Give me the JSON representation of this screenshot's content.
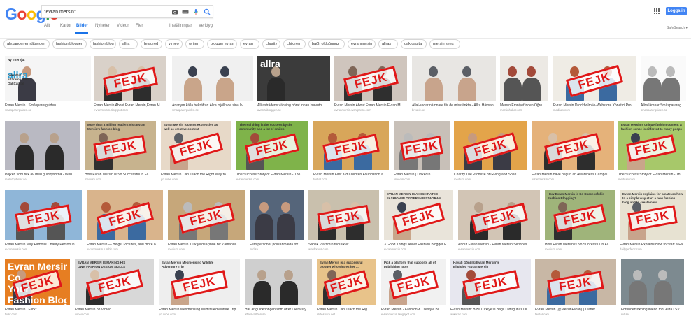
{
  "logo": {
    "letters": [
      "G",
      "o",
      "o",
      "g",
      "l",
      "e"
    ],
    "colors": [
      "#4285F4",
      "#EA4335",
      "#FBBC05",
      "#4285F4",
      "#34A853",
      "#EA4335"
    ]
  },
  "search": {
    "value": "\"evran mersin\"",
    "placeholder": ""
  },
  "tabs": [
    {
      "label": "Allt",
      "active": false
    },
    {
      "label": "Kartor",
      "active": false
    },
    {
      "label": "Bilder",
      "active": true
    },
    {
      "label": "Nyheter",
      "active": false
    },
    {
      "label": "Videor",
      "active": false
    },
    {
      "label": "Fler",
      "active": false
    },
    {
      "label": "Inställningar",
      "active": false
    },
    {
      "label": "Verktyg",
      "active": false
    }
  ],
  "header": {
    "login_label": "Logga in",
    "safesearch_label": "SafeSearch ▾"
  },
  "chips": [
    "alexander erndtberger",
    "fashion blogger",
    "fashion blog",
    "allra",
    "featured",
    "vimeo",
    "writer",
    "blogger evran",
    "evran",
    "charity",
    "children",
    "bağlı olduğunuz",
    "evranmersin",
    "allras",
    "oak capital",
    "mersin sees"
  ],
  "stamp_text": "FEJK",
  "colors": {
    "stamp": "#e01818",
    "link_blue": "#1a73e8",
    "button_blue": "#4285f4"
  },
  "rows": [
    [
      {
        "caption": "Evran Mersin | Småsparerguiden",
        "source": "smasparerguiden.se",
        "stamp": false,
        "overlay": [
          "Ny intervju:",
          "allra",
          "bekräftar",
          "affärerna med",
          "OakCapital"
        ]
      },
      {
        "caption": "Evran Mersin About Evran Mersin,Evran M...",
        "source": "evranmersin.blogspot.com",
        "stamp": true
      },
      {
        "caption": "Ananym källa bekräftar: Allra mjölkade sina liv...",
        "source": "smasparerguiden.se",
        "stamp": false
      },
      {
        "caption": "Allrastrådens vänsing börat innan kravutb...",
        "source": "avanzabloggen.se",
        "stamp": false,
        "overlay": [
          "allra"
        ]
      },
      {
        "caption": "Evran Mersin About Evran Mersin,Evran M...",
        "source": "evranmersin.wordpress.com",
        "stamp": true
      },
      {
        "caption": "Allal-sedar nämnare för de misstänkta - Allra Hävsan",
        "source": "breakit.se",
        "stamp": false
      },
      {
        "caption": "Mersin Emniyet'inden Öğre...",
        "source": "mersinhaber.com",
        "stamp": false
      },
      {
        "caption": "Evran Mersin Drockholm-ie-Webstore Yönetici Progr...",
        "source": "medium.com",
        "stamp": true
      },
      {
        "caption": "Allra lämnar Småsparareg...",
        "source": "smasparerguiden.se",
        "stamp": false
      }
    ],
    [
      {
        "caption": "Pojken som fick av med guldbyxorna - Web...",
        "source": "realtidnyheter.se",
        "stamp": false
      },
      {
        "caption": "How Evran Mersin is So Successful in Fa...",
        "source": "medium.com",
        "stamp": true,
        "overlay": [
          "More than a million readers visit Evran",
          "Mersin's fashion blog"
        ]
      },
      {
        "caption": "Evran Mersin Can Teach the Right Way to...",
        "source": "youtube.com",
        "stamp": true,
        "overlay": [
          "Evran Mersin focuses expressive as",
          "well as creative content"
        ]
      },
      {
        "caption": "The Success Story of Evran Mersin - The...",
        "source": "evranmersin.com",
        "stamp": true,
        "overlay": [
          "The real thing is the success by the",
          "community and a lot of smiles"
        ]
      },
      {
        "caption": "Evran Mersin First Kid Children Foundation a...",
        "source": "twitter.com",
        "stamp": true
      },
      {
        "caption": "Evran Mersin | LinkedIn",
        "source": "linkedin.com",
        "stamp": true
      },
      {
        "caption": "Charity The Promise of Giving and Shari...",
        "source": "medium.com",
        "stamp": true
      },
      {
        "caption": "Evran Mersin have begun an Awareness Campai...",
        "source": "evranmersin.com",
        "stamp": true
      },
      {
        "caption": "The Success Story of Evran Mersin - The...",
        "source": "medium.com",
        "stamp": true,
        "overlay": [
          "Evran Mersin's unique fashion content and the",
          "fashion sense is different to many people"
        ]
      }
    ],
    [
      {
        "caption": "Evran Mersin very Famous Charity Person in...",
        "source": "evranmersin.com",
        "stamp": true
      },
      {
        "caption": "Evran Mersin — Blogs, Pictures, and more o...",
        "source": "evranmersin.tumblr.com",
        "stamp": true
      },
      {
        "caption": "Evran Mersin Türkiye'de İçinde Bir Zamanda ...",
        "source": "medium.com",
        "stamp": true
      },
      {
        "caption": "Fem personer polisanmälda för Allra-skandale...",
        "source": "svd.se",
        "stamp": false
      },
      {
        "caption": "Sabak Vlarf mın tnoüük et...",
        "source": "wordpress.com",
        "stamp": true
      },
      {
        "caption": "3 Good Things About Fashion Blogger E...",
        "source": "evranmersin.com",
        "stamp": true,
        "overlay": [
          "EVRAN MERSIN IS A HIGH RATED",
          "FASHION BLOGGER IN INSTAGRAM"
        ]
      },
      {
        "caption": "About Evran Mersin - Evran Mersin Services",
        "source": "evranmersin.com",
        "stamp": true
      },
      {
        "caption": "How Evran Mersin is So Successful in Fa...",
        "source": "medium.com",
        "stamp": true,
        "overlay": [
          "How Evran Mersin is So Successful in",
          "Fashion Blogging?"
        ]
      },
      {
        "caption": "Evran Mersin Explains How to Start a Fa...",
        "source": "dailyperfectr.com",
        "stamp": true,
        "overlay": [
          "Evran Mersin explains for amateurs how",
          "to a simple way start a new fashion",
          "blog and to create new..."
        ]
      }
    ],
    [
      {
        "caption": "Evran Mersin | Flickr",
        "source": "flickr.com",
        "stamp": true,
        "overlay": [
          "Evran Mersin",
          "Co...",
          "Your",
          "Fashion Blog"
        ]
      },
      {
        "caption": "Evran Mersin on Vimeo",
        "source": "vimeo.com",
        "stamp": true,
        "overlay": [
          "EVRAN MERSIN IS MAKING HIS",
          "OWN FASHION DESIGN SKILLS"
        ]
      },
      {
        "caption": "Evran Mersin Mesmerising Wildlife Adventure Trip ...",
        "source": "youtube.com",
        "stamp": true,
        "overlay": [
          "Evran Mersin Mesmerising Wildlife",
          "Adventure Trip"
        ]
      },
      {
        "caption": "Här är guldkrinngen som ofter i Allra-sty...",
        "source": "affarsvarlden.se",
        "stamp": false
      },
      {
        "caption": "Evran Mersin Can Teach the Rig...",
        "source": "slideshare.net",
        "stamp": true,
        "overlay": [
          "Evran Mersin is a successful",
          "blogger who shares her ..."
        ]
      },
      {
        "caption": "Evran Mersin - Fashion & Lifestyle Bl...",
        "source": "evranmersin.blogspot.com",
        "stamp": true,
        "overlay": [
          "Pick a platform that supports all of",
          "publishing tools"
        ]
      },
      {
        "caption": "Evran Mersin: Bize Türkiye'le Bağlı Olduğunuz Ol...",
        "source": "ankaraz.com",
        "stamp": true,
        "overlay": [
          "Hayati Gönüllü Evran Mersin'le",
          "Bilgiolog -Evran Mersin"
        ]
      },
      {
        "caption": "Evran Mersin (@MersinEvran) | Twitter",
        "source": "twitter.com",
        "stamp": true
      },
      {
        "caption": "Förundersökning inledd mot Allra i SVT...",
        "source": "svt.se",
        "stamp": false
      }
    ]
  ]
}
